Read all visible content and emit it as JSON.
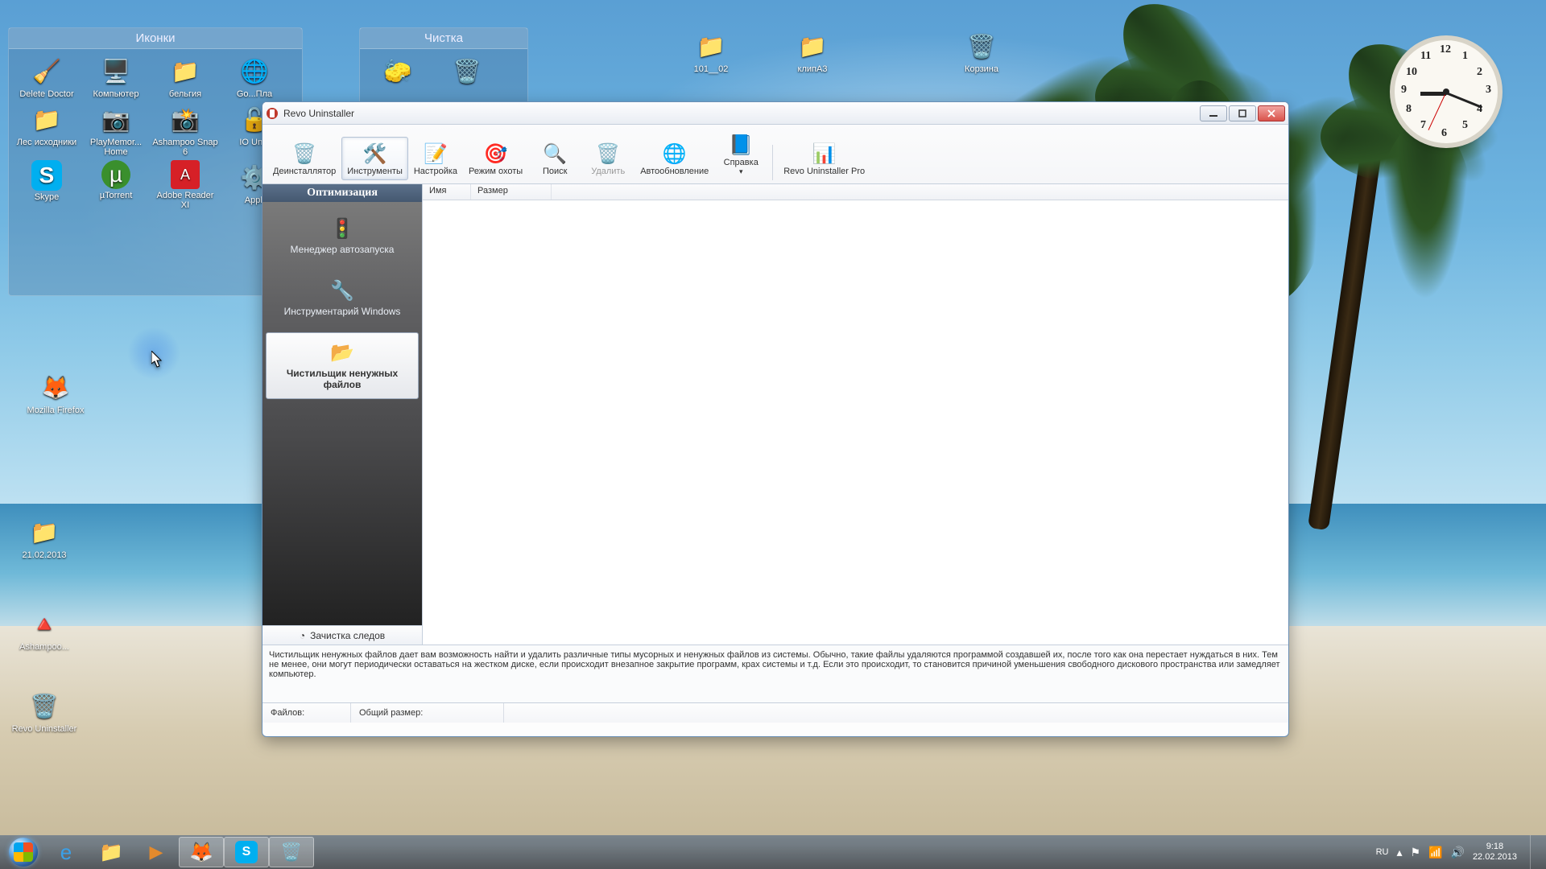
{
  "fences": {
    "icons": {
      "title": "Иконки"
    },
    "clean": {
      "title": "Чистка"
    }
  },
  "desktop_icons": {
    "fence1": [
      "Delete Doctor",
      "Компьютер",
      "бельгия",
      "Go...Пла",
      "Лес исходники",
      "PlayMemor... Home",
      "Ashampoo Snap 6",
      "IO Unlo",
      "Skype",
      "µTorrent",
      "Adobe Reader XI",
      "Appli"
    ],
    "loose": [
      "Mozilla Firefox",
      "21.02.2013",
      "Ashampoo...",
      "Revo Uninstaller",
      "101__02",
      "клипА3",
      "Корзина"
    ]
  },
  "window": {
    "title": "Revo Uninstaller",
    "toolbar": {
      "uninstaller": "Деинсталлятор",
      "tools": "Инструменты",
      "settings": "Настройка",
      "hunter": "Режим охоты",
      "search": "Поиск",
      "delete": "Удалить",
      "autoupdate": "Автообновление",
      "help": "Справка",
      "pro": "Revo Uninstaller Pro"
    },
    "sidebar": {
      "header": "Оптимизация",
      "items": [
        "Менеджер автозапуска",
        "Инструментарий Windows",
        "Чистильщик ненужных файлов"
      ],
      "footer": "Зачистка следов"
    },
    "columns": {
      "name": "Имя",
      "size": "Размер"
    },
    "description": "Чистильщик ненужных файлов дает вам возможность найти и удалить различные типы мусорных и ненужных файлов из системы. Обычно, такие файлы удаляются программой создавшей их, после того как она перестает нуждаться в них. Тем не менее, они могут периодически оставаться на жестком диске, если происходит внезапное закрытие программ, крах системы и т.д. Если это происходит, то становится причиной уменьшения свободного дискового пространства или замедляет компьютер.",
    "status": {
      "files_label": "Файлов:",
      "size_label": "Общий размер:"
    }
  },
  "taskbar": {
    "lang": "RU",
    "time": "9:18",
    "date": "22.02.2013"
  }
}
